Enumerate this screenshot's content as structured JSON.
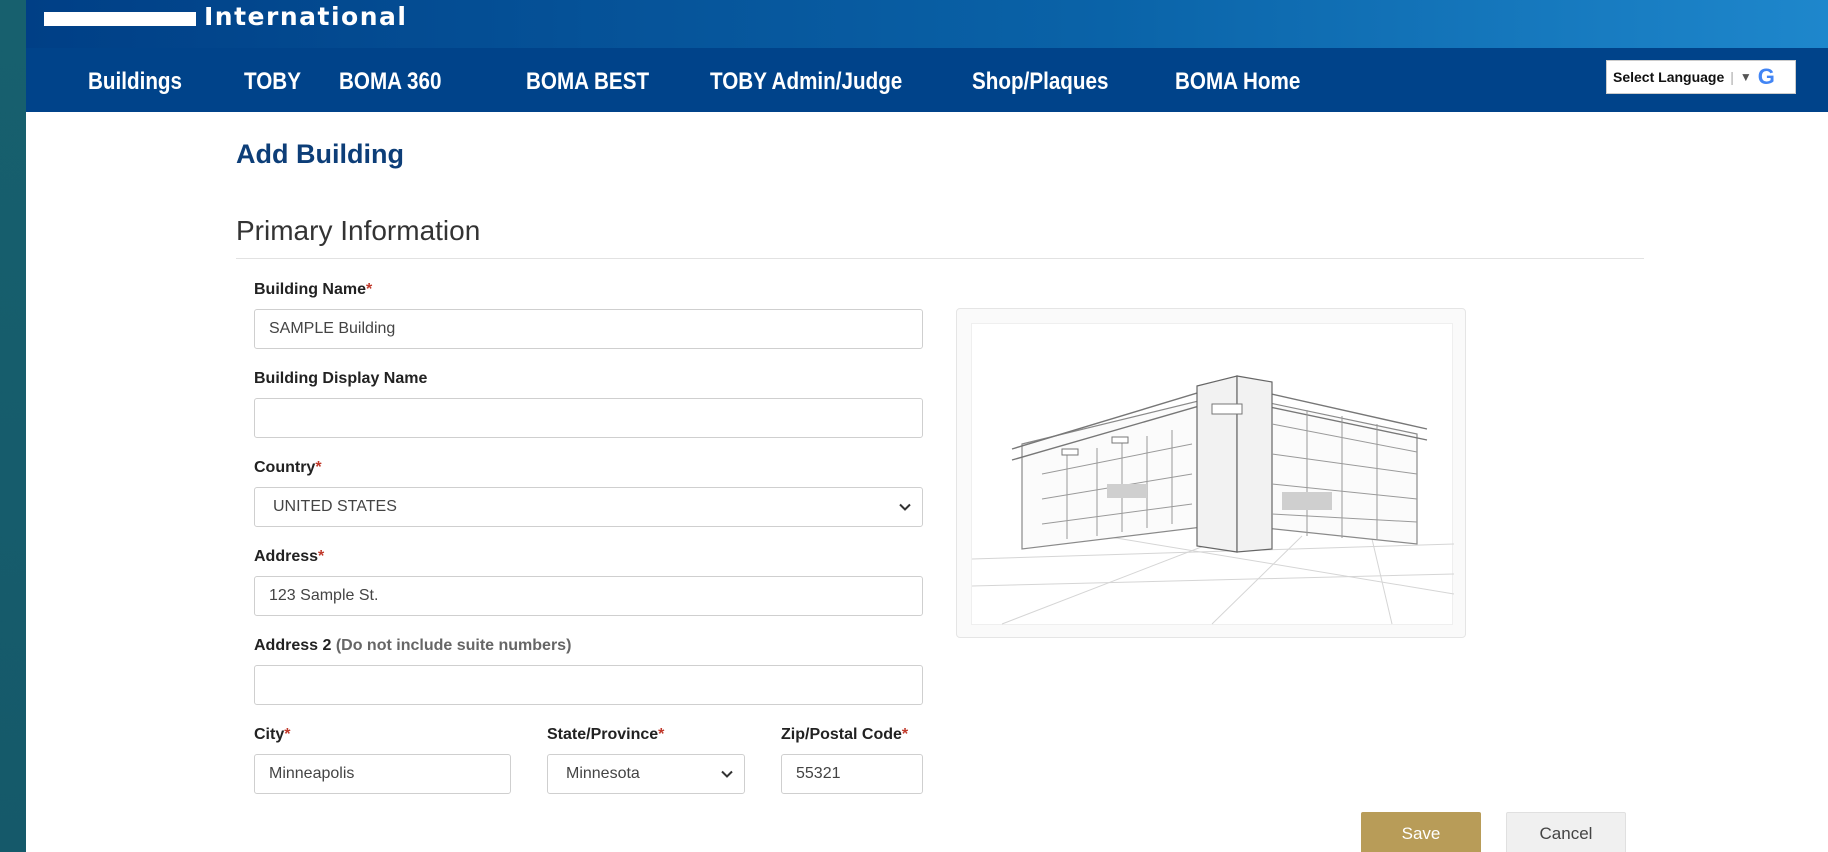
{
  "header": {
    "brand_text": "International",
    "nav": [
      "Buildings",
      "TOBY",
      "BOMA 360",
      "BOMA BEST",
      "TOBY Admin/Judge",
      "Shop/Plaques",
      "BOMA Home"
    ],
    "language": {
      "label": "Select Language",
      "arrow": "▼",
      "google_glyph": "G"
    }
  },
  "page": {
    "title": "Add Building",
    "section_title": "Primary Information"
  },
  "form": {
    "building_name": {
      "label": "Building Name",
      "required": "*",
      "value": "SAMPLE Building"
    },
    "display_name": {
      "label": "Building Display Name",
      "value": ""
    },
    "country": {
      "label": "Country",
      "required": "*",
      "value": "UNITED STATES"
    },
    "address": {
      "label": "Address",
      "required": "*",
      "value": "123 Sample St."
    },
    "address2": {
      "label": "Address 2",
      "hint": "(Do not include suite numbers)",
      "value": ""
    },
    "city": {
      "label": "City",
      "required": "*",
      "value": "Minneapolis"
    },
    "state": {
      "label": "State/Province",
      "required": "*",
      "value": "Minnesota"
    },
    "zip": {
      "label": "Zip/Postal Code",
      "required": "*",
      "value": "55321"
    }
  },
  "actions": {
    "save": "Save",
    "cancel": "Cancel"
  },
  "colors": {
    "nav_bg": "#00438a",
    "title": "#0d3e78",
    "save_bg": "#b89c58",
    "required": "#c0392b"
  },
  "icons": {
    "select_chevron": "chevron-down-icon",
    "building_image": "building-sketch-image"
  }
}
